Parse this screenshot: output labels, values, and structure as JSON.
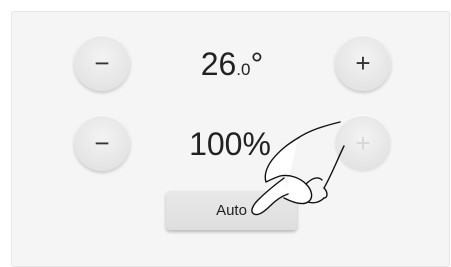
{
  "temperature": {
    "value": "26",
    "decimal": ".0",
    "unit": "°",
    "decrease_symbol": "−",
    "increase_symbol": "+"
  },
  "fan": {
    "value": "100%",
    "decrease_symbol": "−",
    "increase_symbol": "+",
    "increase_disabled": true
  },
  "mode_button": {
    "label": "Auto"
  },
  "pointer": {
    "icon": "hand-pointer-icon"
  }
}
